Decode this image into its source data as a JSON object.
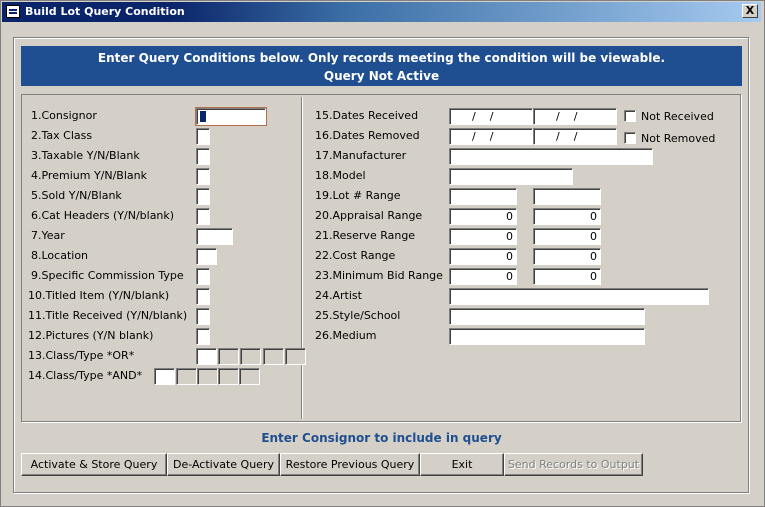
{
  "window": {
    "title": "Build Lot Query Condition",
    "close_label": "X"
  },
  "banner": {
    "line1": "Enter Query Conditions below.  Only records meeting the condition will be viewable.",
    "line2": "Query Not Active"
  },
  "left_fields": [
    "1.Consignor",
    "2.Tax Class",
    "3.Taxable Y/N/Blank",
    "4.Premium Y/N/Blank",
    "5.Sold Y/N/Blank",
    "6.Cat Headers (Y/N/blank)",
    "7.Year",
    "8.Location",
    "9.Specific Commission Type",
    "10.Titled Item (Y/N/blank)",
    "11.Title Received (Y/N/blank)",
    "12.Pictures (Y/N blank)",
    "13.Class/Type *OR*",
    "14.Class/Type *AND*"
  ],
  "right_fields": [
    "15.Dates Received",
    "16.Dates Removed",
    "17.Manufacturer",
    "18.Model",
    "19.Lot # Range",
    "20.Appraisal Range",
    "21.Reserve Range",
    "22.Cost Range",
    "23.Minimum Bid Range",
    "24.Artist",
    "25.Style/School",
    "26.Medium"
  ],
  "date_placeholder": "/    /",
  "range_values": {
    "appraisal_from": "0",
    "appraisal_to": "0",
    "reserve_from": "0",
    "reserve_to": "0",
    "cost_from": "0",
    "cost_to": "0",
    "min_bid_from": "0",
    "min_bid_to": "0"
  },
  "checkboxes": {
    "not_received": "Not Received",
    "not_removed": "Not Removed"
  },
  "hint": "Enter Consignor to include in query",
  "buttons": {
    "activate": "Activate & Store Query",
    "deactivate": "De-Activate Query",
    "restore": "Restore Previous Query",
    "exit": "Exit",
    "send": "Send Records to Output"
  }
}
